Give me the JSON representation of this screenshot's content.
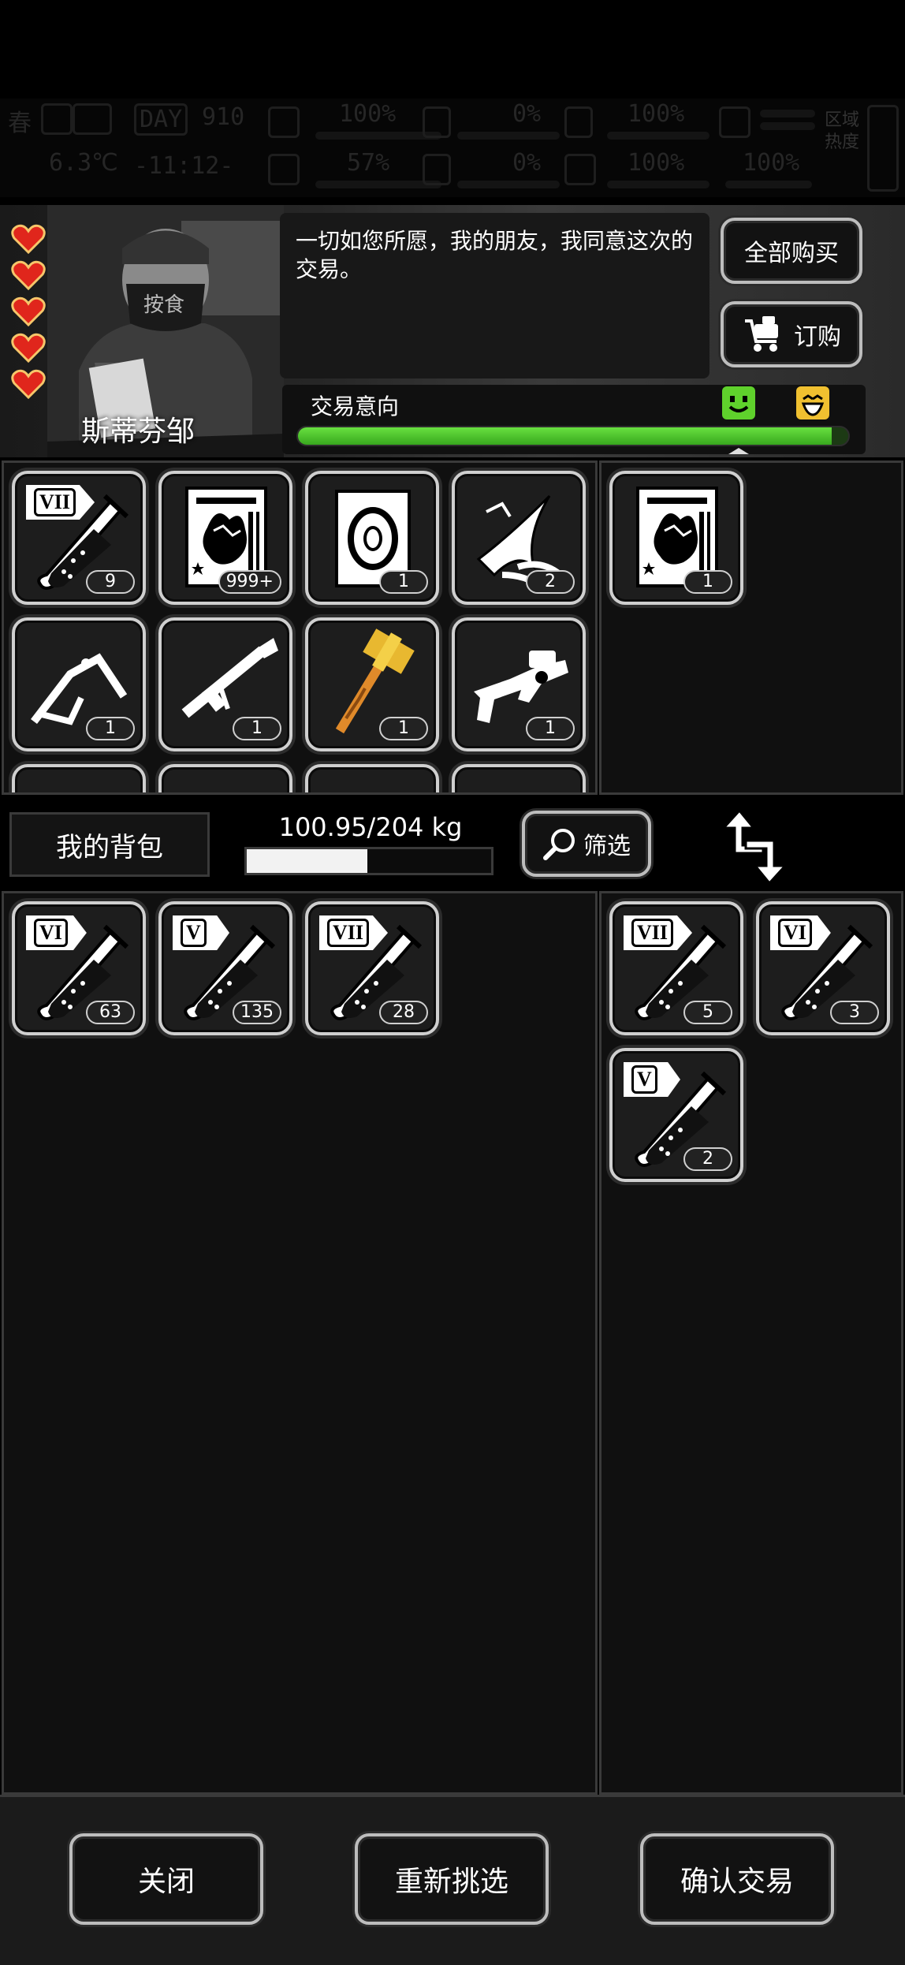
{
  "status_bar": {
    "season": "春",
    "day_label": "DAY",
    "day_value": "910",
    "temperature": "6.3℃",
    "time": "-11:12-",
    "health": "100%",
    "hunger": "0%",
    "defense": "100%",
    "infection": "57%",
    "bleed": "0%",
    "heart": "100%",
    "energy": "100%",
    "area_heat_label": "区域热度"
  },
  "trader": {
    "name": "斯蒂芬邹",
    "hearts": 5,
    "dialog": "一切如您所愿，我的朋友，我同意这次的交易。",
    "buy_all_label": "全部购买",
    "order_label": "订购",
    "trade_intent_label": "交易意向",
    "trade_intent_level": 0.97
  },
  "trader_inventory": [
    {
      "name": "serum-vii",
      "tier": "VII",
      "count": "9"
    },
    {
      "name": "zombie-card",
      "count": "999+"
    },
    {
      "name": "tire-manual",
      "count": "1"
    },
    {
      "name": "claw-blade",
      "count": "2"
    },
    {
      "name": "bipod",
      "count": "1"
    },
    {
      "name": "rocket-launcher",
      "count": "1"
    },
    {
      "name": "golden-hammer",
      "count": "1"
    },
    {
      "name": "grenade-launcher",
      "count": "1"
    }
  ],
  "trader_offer": [
    {
      "name": "zombie-card",
      "count": "1"
    }
  ],
  "backpack": {
    "label": "我的背包",
    "weight_text": "100.95/204 kg",
    "weight_fraction": 0.495,
    "filter_label": "筛选"
  },
  "my_inventory": [
    {
      "name": "serum-vi",
      "tier": "VI",
      "count": "63"
    },
    {
      "name": "serum-v",
      "tier": "V",
      "count": "135"
    },
    {
      "name": "serum-vii",
      "tier": "VII",
      "count": "28"
    }
  ],
  "my_offer": [
    {
      "name": "serum-vii",
      "tier": "VII",
      "count": "5"
    },
    {
      "name": "serum-vi",
      "tier": "VI",
      "count": "3"
    },
    {
      "name": "serum-v",
      "tier": "V",
      "count": "2"
    }
  ],
  "footer": {
    "close_label": "关闭",
    "reselect_label": "重新挑选",
    "confirm_label": "确认交易"
  },
  "colors": {
    "intent_green": "#4cc42a",
    "face_green": "#5fd12c",
    "face_yellow": "#f0c030",
    "heart_red": "#e0261c",
    "slot_border": "#cfcfcf"
  }
}
